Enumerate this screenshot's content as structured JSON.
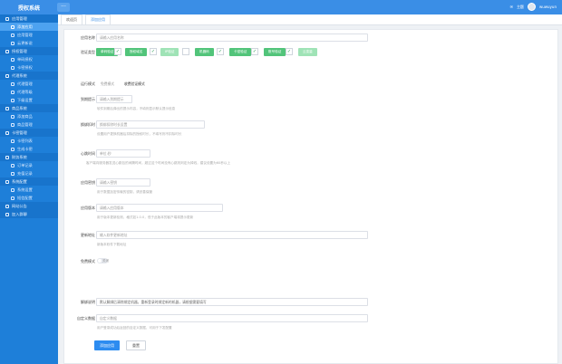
{
  "app": {
    "brand": "授权系统",
    "collapse": "···"
  },
  "topbar": {
    "notice": "主题",
    "user": "wuwuyun"
  },
  "sidebar": {
    "groups": [
      {
        "label": "应用管理",
        "items": [
          "添加应用",
          "应用管理",
          "云更新说"
        ]
      },
      {
        "label": "授权管理",
        "items": [
          "单码授权",
          "卡密授权"
        ]
      },
      {
        "label": "代理系统",
        "items": [
          "代理管理",
          "代理等级",
          "下级设置"
        ]
      },
      {
        "label": "商品系统",
        "items": [
          "添加商品",
          "商品管理"
        ]
      },
      {
        "label": "卡密管理",
        "items": [
          "卡密列表",
          "生成卡密"
        ]
      },
      {
        "label": "财务系统",
        "items": [
          "订单记录",
          "充值记录"
        ]
      },
      {
        "label": "系统配置",
        "items": [
          "系统设置",
          "短信配置"
        ]
      },
      {
        "label": "网站公告",
        "items": []
      },
      {
        "label": "加入群聊",
        "items": []
      }
    ]
  },
  "tabs": [
    {
      "label": "欢迎页"
    },
    {
      "label": "添加应用"
    }
  ],
  "form": {
    "app_name": {
      "label": "应用名称",
      "placeholder": "请输入应用名称"
    },
    "verify_mode": {
      "label": "验证类型",
      "options": [
        "单码验证",
        "授权域名",
        "IP验证",
        "机器码",
        "卡密验证",
        "账号验证",
        "云变量"
      ]
    },
    "mode": {
      "label": "运行模式",
      "default": "免费模式",
      "selected": "收费验证模式"
    },
    "expire_tip": {
      "label": "到期提示",
      "placeholder": "请输入到期提示",
      "hint": "软件到期后弹出的提示内容，不填则显示默认提示信息"
    },
    "bind_mode": {
      "label": "换绑扣时",
      "placeholder": "换绑扣除时长设置",
      "hint": "设置用户更换机器后扣除的授权时长，不填写则不扣除时长"
    },
    "heartbeat": {
      "label": "心跳时间",
      "placeholder": "单位:秒",
      "hint": "客户端向服务器发送心跳包的间隔时间，超过这个时间没有心跳则判定为掉线，建议设置为60秒以上"
    },
    "app_key": {
      "label": "应用密钥",
      "placeholder": "请输入密钥",
      "hint": "用于数据加密传输的密钥，请妥善保管"
    },
    "version": {
      "label": "应用版本",
      "placeholder": "请输入应用版本",
      "hint": "用于版本更新检测，格式如1.0.0，低于此版本的客户端将提示更新"
    },
    "update_url": {
      "label": "更新地址",
      "placeholder": "输入软件更新地址",
      "hint": "新版本软件下载地址"
    },
    "free_mode": {
      "label": "免费模式",
      "value": "关闭"
    },
    "unbind_notice": {
      "label": "解绑说明",
      "value": "默认解绑后清除绑定机器，重新登录时绑定新的机器，请根据需要填写"
    },
    "custom_data": {
      "label": "自定义数据",
      "placeholder": "自定义数据",
      "hint": "用户登录成功后返回的自定义数据，可用于下发配置"
    },
    "submit_label": "添加应用",
    "reset_label": "重置"
  }
}
